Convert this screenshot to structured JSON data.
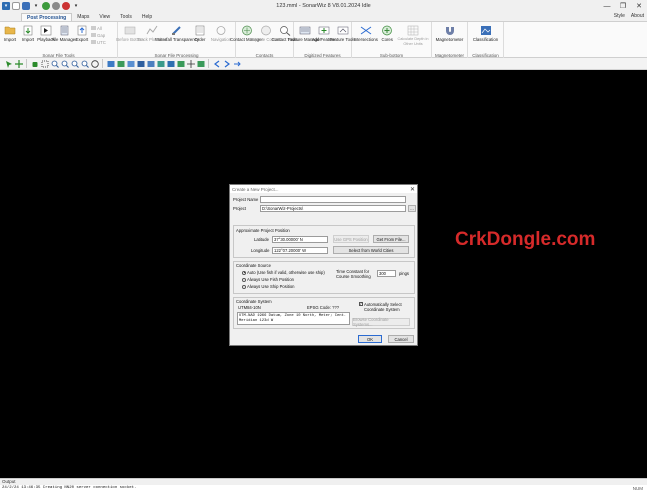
{
  "window": {
    "title": "123.mml - SonarWiz 8 V8.01.2024 Idle",
    "controls": [
      "—",
      "❐",
      "✕"
    ]
  },
  "ribbon_tabs": [
    {
      "label": "Post Processing",
      "active": true
    },
    {
      "label": "Maps",
      "active": false
    },
    {
      "label": "View",
      "active": false
    },
    {
      "label": "Tools",
      "active": false
    },
    {
      "label": "Help",
      "active": false
    }
  ],
  "ribbon_right": {
    "style": "Style",
    "about": "About"
  },
  "ribbon_groups": {
    "sonar_file_tools": {
      "label": "Sonar File Tools",
      "buttons": [
        {
          "label": "Import",
          "icon": "folder-icon"
        },
        {
          "label": "Import",
          "icon": "import-icon"
        },
        {
          "label": "Playback",
          "icon": "play-icon"
        },
        {
          "label": "File Manager",
          "icon": "file-manager-icon"
        },
        {
          "label": "Export",
          "icon": "export-icon"
        }
      ],
      "small_items": [
        "All",
        "Gap",
        "UTC"
      ]
    },
    "sonar_file_processing": {
      "label": "Sonar File Processing",
      "buttons": [
        {
          "label": "Before Bottom",
          "icon": "before-icon",
          "disabled": true
        },
        {
          "label": "Track Plot View",
          "icon": "track-icon",
          "disabled": true
        },
        {
          "label": "Waterfall Transparency",
          "icon": "waterfall-icon",
          "disabled": false
        },
        {
          "label": "Order",
          "icon": "order-icon",
          "disabled": false
        },
        {
          "label": "Navigation",
          "icon": "navigation-icon",
          "disabled": true
        }
      ]
    },
    "contacts": {
      "label": "Contacts",
      "buttons": [
        {
          "label": "Contact Manager",
          "icon": "contact-manager-icon",
          "disabled": false
        },
        {
          "label": "Capture Contact",
          "icon": "capture-icon",
          "disabled": true
        },
        {
          "label": "Contact Tools",
          "icon": "contact-tools-icon",
          "disabled": false
        }
      ]
    },
    "digitized_features": {
      "label": "Digitized Features",
      "buttons": [
        {
          "label": "Feature Manager",
          "icon": "feature-manager-icon"
        },
        {
          "label": "Add Feature",
          "icon": "add-feature-icon"
        },
        {
          "label": "Feature Tools",
          "icon": "feature-tools-icon"
        }
      ]
    },
    "sub_bottom": {
      "label": "Sub-bottom",
      "buttons": [
        {
          "label": "Intersections",
          "icon": "intersections-icon",
          "disabled": false
        },
        {
          "label": "Cores",
          "icon": "cores-icon",
          "disabled": false
        },
        {
          "label": "Calculate Depth in Other Units",
          "icon": "calculate-icon",
          "disabled": true
        }
      ]
    },
    "magnetometer": {
      "label": "Magnetometer",
      "buttons": [
        {
          "label": "Magnetometer",
          "icon": "magnet-icon"
        }
      ]
    },
    "classification": {
      "label": "Classification",
      "buttons": [
        {
          "label": "Classification",
          "icon": "classification-icon"
        }
      ]
    }
  },
  "toolbar_icons": [
    "pointer-icon",
    "pan-icon",
    "hand-icon",
    "select-icon",
    "zoom-in-icon",
    "zoom-out-icon",
    "zoom-box-icon",
    "zoom-extent-icon",
    "globe-icon",
    "layer-icon",
    "map-icon",
    "grid-icon",
    "image-icon",
    "chart-icon",
    "chart-icon",
    "measure-icon",
    "cursor-icon",
    "crosshair-icon",
    "snap-icon",
    "back-icon",
    "forward-icon",
    "refresh-icon"
  ],
  "watermark": "CrkDongle.com",
  "dialog": {
    "title": "Create a New Project...",
    "close": "✕",
    "project_name_label": "Project Name",
    "project_name_value": "",
    "project_label": "Project",
    "project_value": "D:\\SonarWiz-Projects\\",
    "browse_label": "...",
    "approx_position": {
      "title": "Approximate Project Position",
      "latitude_label": "Latitude",
      "latitude_value": "37°30.00000' N",
      "longitude_label": "Longitude",
      "longitude_value": "122°07.20000' W",
      "use_gps_button": "Use GPS Position",
      "get_from_file_button": "Get From File...",
      "select_world_cities_button": "Select from World Cities"
    },
    "coordinate_source": {
      "title": "Coordinate Source",
      "options": [
        {
          "label": "Auto (Use fish if valid, otherwise use ship)",
          "selected": true
        },
        {
          "label": "Always Use Fish Position",
          "selected": false
        },
        {
          "label": "Always Use Ship Position",
          "selected": false
        }
      ],
      "time_constant_label": "Time Constant for Course Smoothing",
      "time_constant_value": "300",
      "pings_label": "pings"
    },
    "coordinate_system": {
      "title": "Coordinate System",
      "utm_label": "UTM84-10N",
      "epsg_label": "EPSG Code: ???",
      "auto_select_label": "Automatically Select Coordinate System",
      "auto_select_checked": true,
      "description": "UTM-NAD 1966 Datum, Zone 10 North, Meter; Cent.\nMeridian 123d W",
      "browse_button": "Browse Coordinate Systems..."
    },
    "ok_button": "OK",
    "cancel_button": "Cancel"
  },
  "output": {
    "title": "Output",
    "line": "24/2/24 13:46:35  Creating NN20 server connection socket.",
    "status": "NUM"
  }
}
